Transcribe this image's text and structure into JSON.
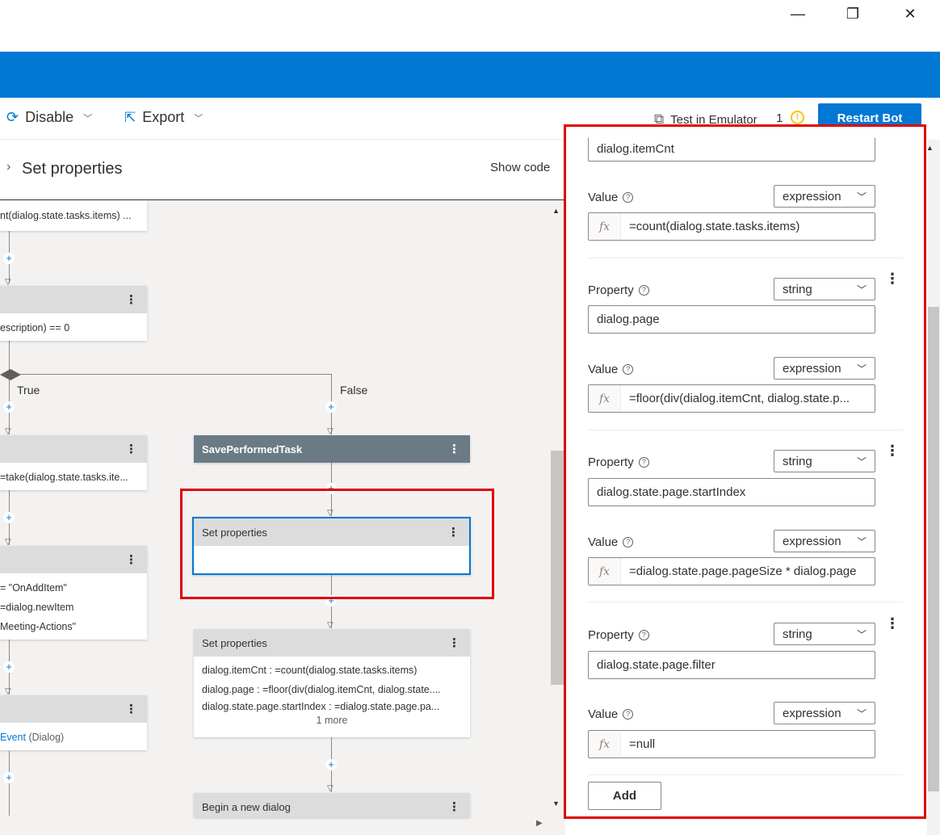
{
  "window": {
    "minimize_glyph": "—",
    "restore_glyph": "❐",
    "close_glyph": "✕"
  },
  "toolbar": {
    "disable_label": "Disable",
    "export_label": "Export",
    "test_emulator_label": "Test in Emulator",
    "notification_count": "1",
    "restart_label": "Restart Bot"
  },
  "breadcrumb": {
    "current": "Set properties",
    "show_code": "Show code"
  },
  "canvas": {
    "top_node_text": "nt(dialog.state.tasks.items) ...",
    "cond_node_text": "escription) == 0",
    "branch_true": "True",
    "branch_false": "False",
    "left_node3_text": "=take(dialog.state.tasks.ite...",
    "left_node4_lines": [
      "= \"OnAddItem\"",
      "=dialog.newItem",
      "Meeting-Actions\""
    ],
    "left_node5_event": "Event",
    "left_node5_suffix": " (Dialog)",
    "save_task_title": "SavePerformedTask",
    "selected_node_title": "Set properties",
    "setprops_title": "Set properties",
    "setprops_lines": [
      "dialog.itemCnt : =count(dialog.state.tasks.items)",
      "dialog.page : =floor(div(dialog.itemCnt, dialog.state....",
      "dialog.state.page.startIndex : =dialog.state.page.pa..."
    ],
    "setprops_more": "1 more",
    "begin_dialog_title": "Begin a new dialog"
  },
  "panel": {
    "property_label": "Property",
    "value_label": "Value",
    "add_label": "Add",
    "fx_glyph": "fx",
    "groups": [
      {
        "property": "dialog.itemCnt",
        "property_type": "",
        "value_type": "expression",
        "value": "=count(dialog.state.tasks.items)"
      },
      {
        "property": "dialog.page",
        "property_type": "string",
        "value_type": "expression",
        "value": "=floor(div(dialog.itemCnt, dialog.state.p..."
      },
      {
        "property": "dialog.state.page.startIndex",
        "property_type": "string",
        "value_type": "expression",
        "value": "=dialog.state.page.pageSize * dialog.page"
      },
      {
        "property": "dialog.state.page.filter",
        "property_type": "string",
        "value_type": "expression",
        "value": "=null"
      }
    ]
  },
  "colors": {
    "accent": "#0078d4",
    "highlight": "#e00000",
    "dark_node": "#6b7b86"
  }
}
